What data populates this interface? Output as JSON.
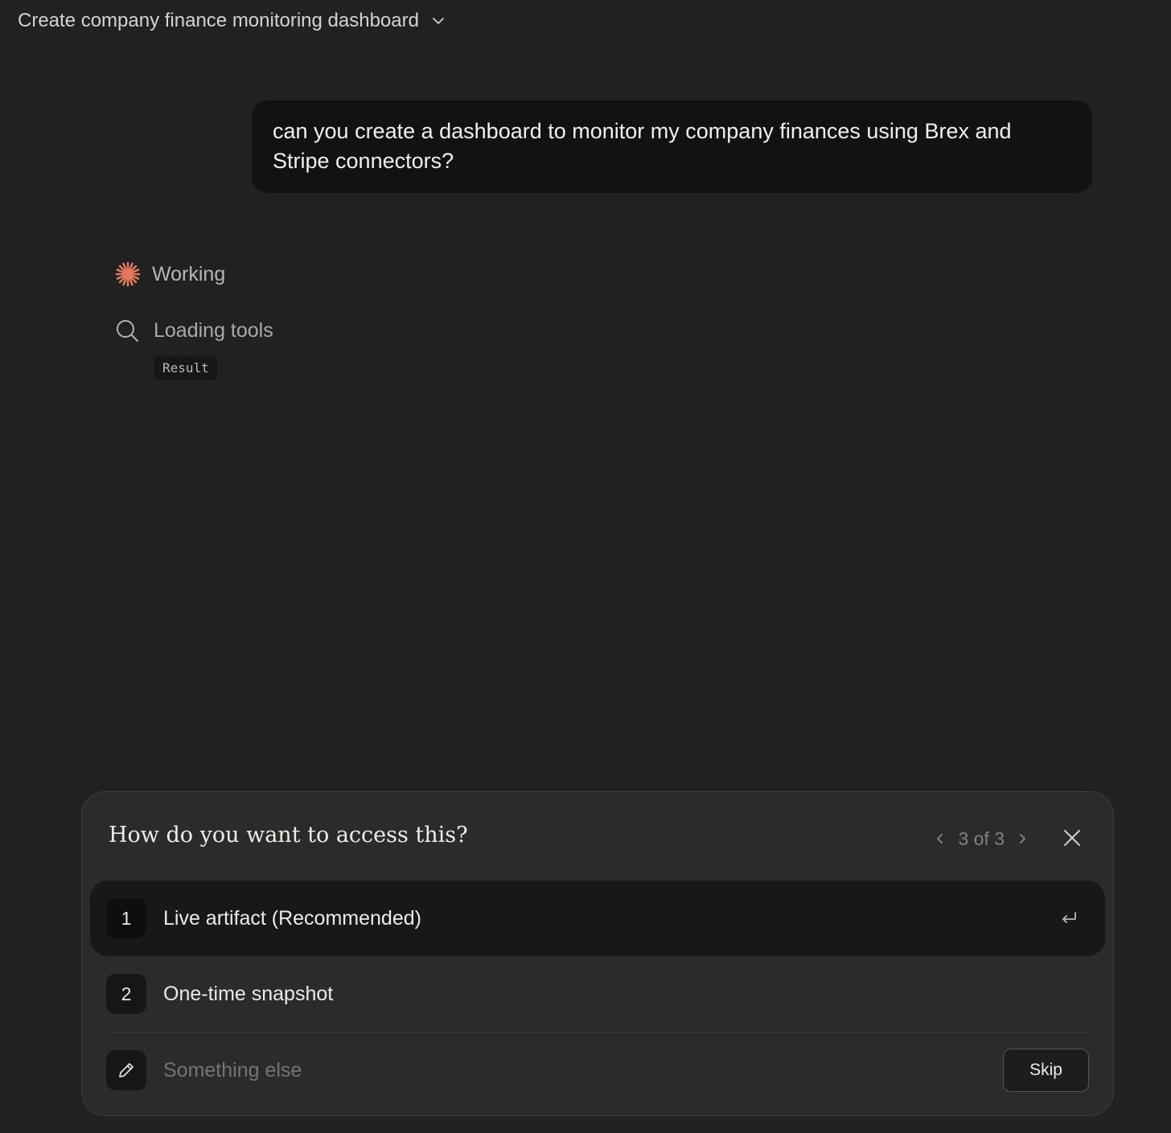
{
  "header": {
    "title": "Create company finance monitoring dashboard",
    "chevron_icon": "chevron-down-icon"
  },
  "conversation": {
    "user_message": "can you create a dashboard to monitor my company finances using Brex and Stripe connectors?",
    "status": {
      "label": "Working",
      "icon": "asterisk-spinner-icon",
      "color": "#e07a5a"
    },
    "tool_call": {
      "label": "Loading tools",
      "icon": "search-icon",
      "result_label": "Result"
    }
  },
  "question_panel": {
    "title": "How do you want to access this?",
    "pager": {
      "count": "3 of 3"
    },
    "options": [
      {
        "number": "1",
        "label": "Live artifact (Recommended)",
        "selected": true
      },
      {
        "number": "2",
        "label": "One-time snapshot",
        "selected": false
      }
    ],
    "custom": {
      "placeholder": "Something else"
    },
    "skip_label": "Skip"
  },
  "colors": {
    "background": "#212121",
    "panel": "#2b2b2b",
    "accent": "#e07a5a"
  }
}
